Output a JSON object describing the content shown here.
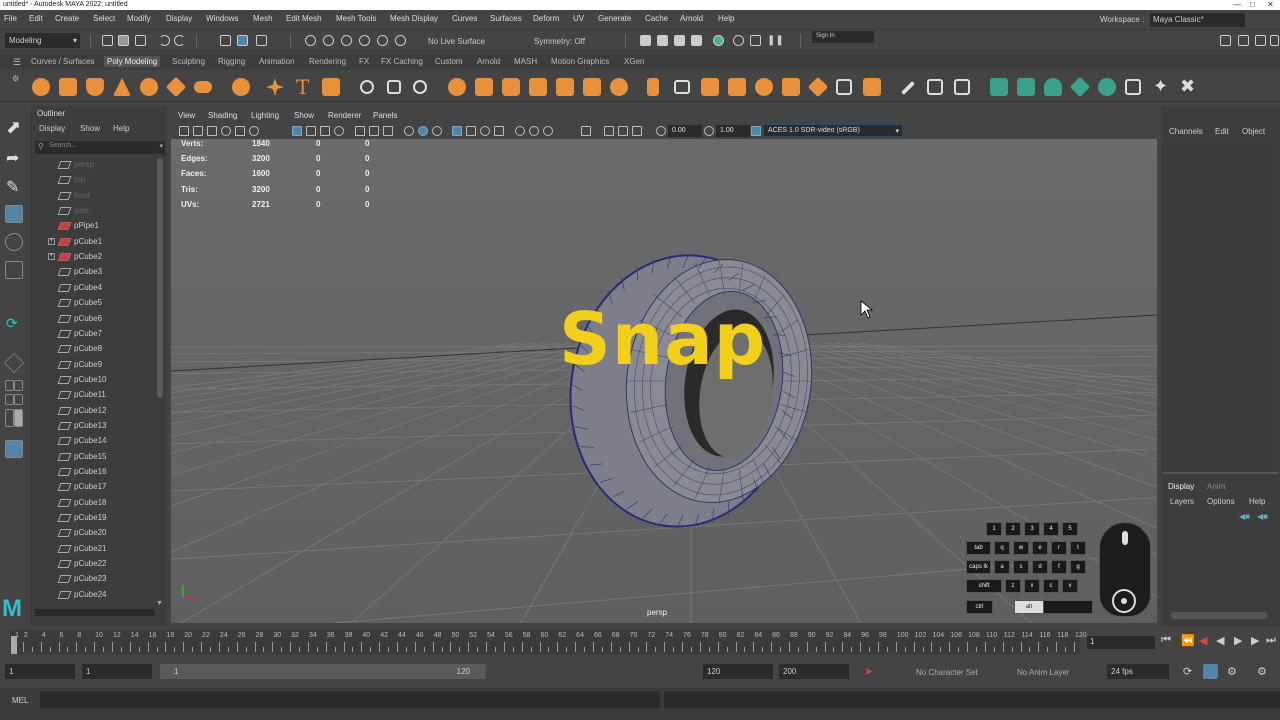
{
  "window_title": "untitled* - Autodesk MAYA 2022: untitled",
  "menus": [
    "File",
    "Edit",
    "Create",
    "Select",
    "Modify",
    "Display",
    "Windows",
    "Mesh",
    "Edit Mesh",
    "Mesh Tools",
    "Mesh Display",
    "Curves",
    "Surfaces",
    "Deform",
    "UV",
    "Generate",
    "Cache",
    "Arnold",
    "Help"
  ],
  "workspace": {
    "label": "Workspace :",
    "value": "Maya Classic*"
  },
  "status_line": {
    "mode": "Modeling",
    "live_surface": "No Live Surface",
    "symmetry": "Symmetry: Off",
    "sign_in": "Sign In"
  },
  "shelf_tabs": [
    "Curves / Surfaces",
    "Poly Modeling",
    "Sculpting",
    "Rigging",
    "Animation",
    "Rendering",
    "FX",
    "FX Caching",
    "Custom",
    "Arnold",
    "MASH",
    "Motion Graphics",
    "XGen"
  ],
  "shelf_active": "Poly Modeling",
  "outliner": {
    "title": "Outliner",
    "menu": [
      "Display",
      "Show",
      "Help"
    ],
    "search_placeholder": "Search...",
    "items": [
      {
        "name": "persp",
        "type": "camera"
      },
      {
        "name": "top",
        "type": "camera"
      },
      {
        "name": "front",
        "type": "camera"
      },
      {
        "name": "side",
        "type": "camera"
      },
      {
        "name": "pPipe1",
        "type": "mesh"
      },
      {
        "name": "pCube1",
        "type": "group"
      },
      {
        "name": "pCube2",
        "type": "group"
      },
      {
        "name": "pCube3",
        "type": "mesh"
      },
      {
        "name": "pCube4",
        "type": "mesh"
      },
      {
        "name": "pCube5",
        "type": "mesh"
      },
      {
        "name": "pCube6",
        "type": "mesh"
      },
      {
        "name": "pCube7",
        "type": "mesh"
      },
      {
        "name": "pCube8",
        "type": "mesh"
      },
      {
        "name": "pCube9",
        "type": "mesh"
      },
      {
        "name": "pCube10",
        "type": "mesh"
      },
      {
        "name": "pCube11",
        "type": "mesh"
      },
      {
        "name": "pCube12",
        "type": "mesh"
      },
      {
        "name": "pCube13",
        "type": "mesh"
      },
      {
        "name": "pCube14",
        "type": "mesh"
      },
      {
        "name": "pCube15",
        "type": "mesh"
      },
      {
        "name": "pCube16",
        "type": "mesh"
      },
      {
        "name": "pCube17",
        "type": "mesh"
      },
      {
        "name": "pCube18",
        "type": "mesh"
      },
      {
        "name": "pCube19",
        "type": "mesh"
      },
      {
        "name": "pCube20",
        "type": "mesh"
      },
      {
        "name": "pCube21",
        "type": "mesh"
      },
      {
        "name": "pCube22",
        "type": "mesh"
      },
      {
        "name": "pCube23",
        "type": "mesh"
      },
      {
        "name": "pCube24",
        "type": "mesh"
      }
    ]
  },
  "viewport": {
    "menu": [
      "View",
      "Shading",
      "Lighting",
      "Show",
      "Renderer",
      "Panels"
    ],
    "near_value": "0.00",
    "far_value": "1.00",
    "color_space": "ACES 1.0 SDR-video (sRGB)",
    "camera_label": "persp",
    "overlay_text": "Snap",
    "hud": [
      {
        "label": "Verts:",
        "v1": "1840",
        "v2": "0",
        "v3": "0"
      },
      {
        "label": "Edges:",
        "v1": "3200",
        "v2": "0",
        "v3": "0"
      },
      {
        "label": "Faces:",
        "v1": "1600",
        "v2": "0",
        "v3": "0"
      },
      {
        "label": "Tris:",
        "v1": "3200",
        "v2": "0",
        "v3": "0"
      },
      {
        "label": "UVs:",
        "v1": "2721",
        "v2": "0",
        "v3": "0"
      }
    ]
  },
  "keyboard_overlay": {
    "row1": [
      "1",
      "2",
      "3",
      "4",
      "5"
    ],
    "row2": [
      "tab",
      "q",
      "w",
      "e",
      "r",
      "t"
    ],
    "row3": [
      "caps lk",
      "a",
      "s",
      "d",
      "f",
      "g"
    ],
    "row4": [
      "shift",
      "z",
      "x",
      "c",
      "v"
    ],
    "row5": [
      "ctrl",
      "alt"
    ]
  },
  "channel_box": {
    "menu": [
      "Channels",
      "Edit",
      "Object"
    ]
  },
  "layer_editor": {
    "tabs": [
      "Display",
      "Anim"
    ],
    "menu": [
      "Layers",
      "Options",
      "Help"
    ]
  },
  "timeline": {
    "current_frame": "1",
    "labels": [
      "1",
      "2",
      "4",
      "6",
      "8",
      "10",
      "12",
      "14",
      "16",
      "18",
      "20",
      "22",
      "24",
      "26",
      "28",
      "30",
      "32",
      "34",
      "36",
      "38",
      "40",
      "42",
      "44",
      "46",
      "48",
      "50",
      "52",
      "54",
      "56",
      "58",
      "60",
      "62",
      "64",
      "66",
      "68",
      "70",
      "72",
      "74",
      "76",
      "78",
      "80",
      "82",
      "84",
      "86",
      "88",
      "90",
      "92",
      "94",
      "96",
      "98",
      "100",
      "102",
      "104",
      "106",
      "108",
      "110",
      "112",
      "114",
      "116",
      "118",
      "120"
    ]
  },
  "range": {
    "start": "1",
    "start2": "1",
    "slider_start": "1",
    "slider_end": "120",
    "end": "120",
    "end2": "200",
    "character_set": "No Character Set",
    "anim_layer": "No Anim Layer",
    "fps": "24 fps"
  },
  "command_line": {
    "label": "MEL"
  },
  "colors": {
    "accent": "#5285a6",
    "overlay_text": "#f2d01a",
    "maya_logo": "#2cc0d0"
  }
}
